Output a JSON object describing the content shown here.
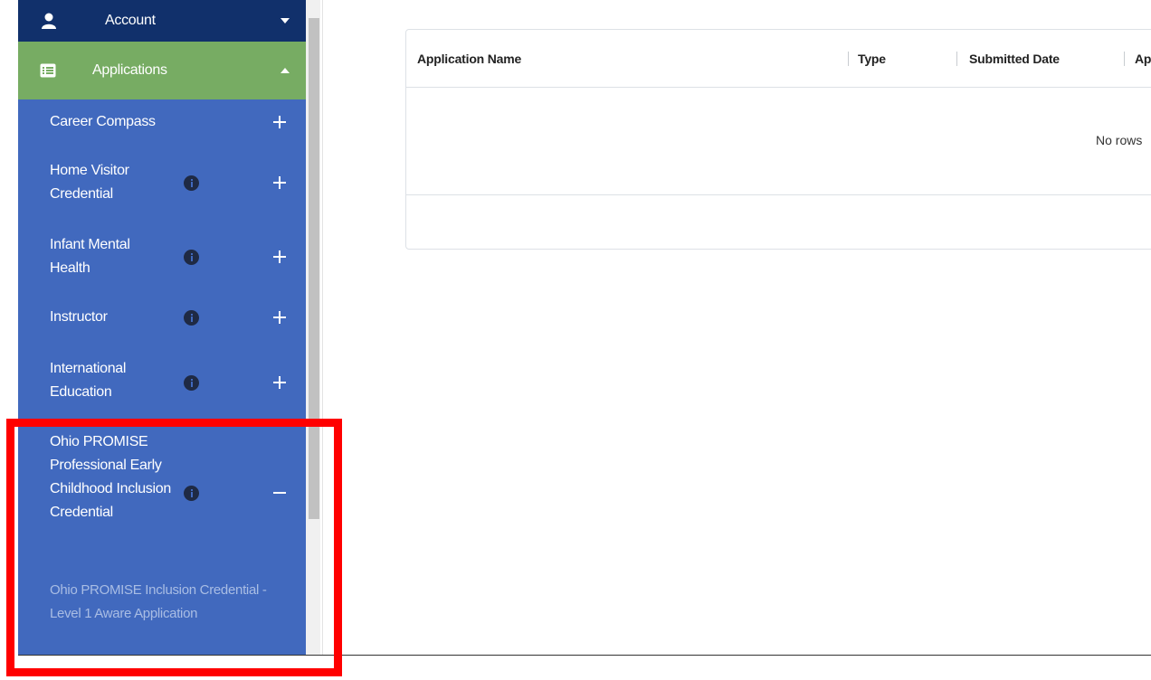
{
  "sidebar": {
    "account_label": "Account",
    "applications_label": "Applications",
    "items": [
      {
        "label": "Career Compass",
        "info": false,
        "toggle": "plus"
      },
      {
        "label": "Home Visitor Credential",
        "info": true,
        "toggle": "plus"
      },
      {
        "label": "Infant Mental Health",
        "info": true,
        "toggle": "plus"
      },
      {
        "label": "Instructor",
        "info": true,
        "toggle": "plus"
      },
      {
        "label": "International Education",
        "info": true,
        "toggle": "plus"
      },
      {
        "label": "Ohio PROMISE Professional Early Childhood Inclusion Credential",
        "info": true,
        "toggle": "minus"
      }
    ],
    "subitem_label": "Ohio PROMISE Inclusion Credential - Level 1 Aware Application"
  },
  "grid": {
    "columns": [
      "Application Name",
      "Type",
      "Submitted Date",
      "Ap"
    ],
    "empty_text": "No rows"
  },
  "colors": {
    "sidebar_bg": "#4169be",
    "account_bg": "#11306b",
    "applications_bg": "#77ac63",
    "highlight": "#ff0000"
  }
}
